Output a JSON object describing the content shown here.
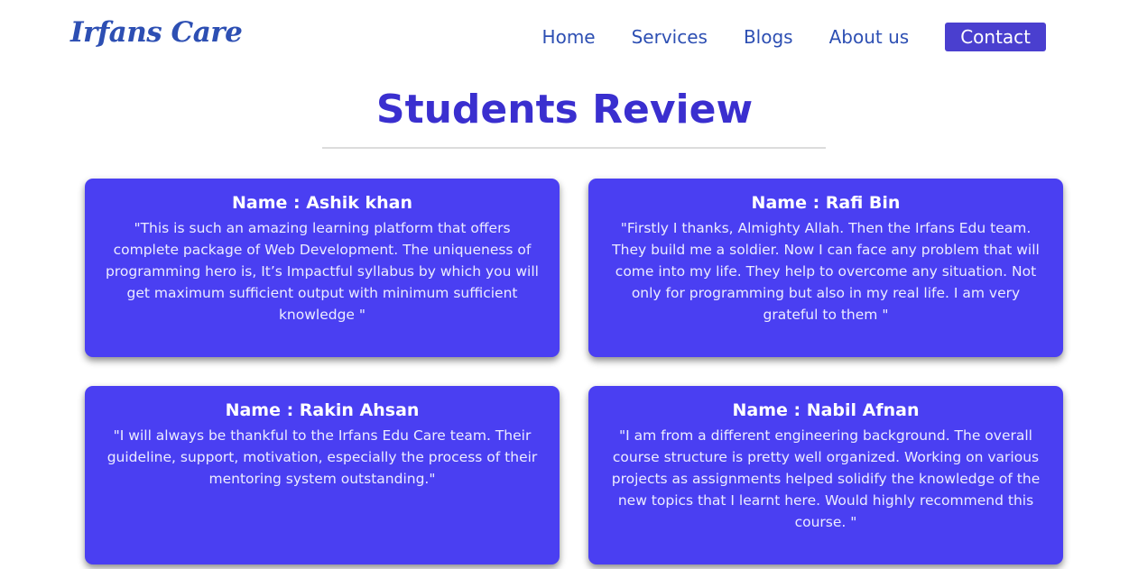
{
  "brand": {
    "name": "Irfans Care"
  },
  "nav": {
    "home": "Home",
    "services": "Services",
    "blogs": "Blogs",
    "about": "About us",
    "contact": "Contact"
  },
  "section": {
    "title": "Students Review"
  },
  "reviews": [
    {
      "name": "Name : Ashik khan",
      "text": "\"This is such an amazing learning platform that offers complete package of Web Development. The uniqueness of programming hero is, It’s Impactful syllabus by which you will get maximum sufficient output with minimum sufficient knowledge \""
    },
    {
      "name": "Name : Rafi Bin",
      "text": "\"Firstly I thanks, Almighty Allah. Then the Irfans Edu team. They build me a soldier. Now I can face any problem that will come into my life. They help to overcome any situation. Not only for programming but also in my real life. I am very grateful to them \""
    },
    {
      "name": "Name : Rakin Ahsan",
      "text": "\"I will always be thankful to the Irfans Edu Care team. Their guideline, support, motivation, especially the process of their mentoring system outstanding.\""
    },
    {
      "name": "Name : Nabil Afnan",
      "text": "\"I am from a different engineering background. The overall course structure is pretty well organized. Working on various projects as assignments helped solidify the knowledge of the new topics that I learnt here. Would highly recommend this course. \""
    }
  ],
  "colors": {
    "brand": "#2d4fb3",
    "accent": "#4a3fcf",
    "card": "#4a3ff2",
    "title": "#3a2fcf"
  }
}
